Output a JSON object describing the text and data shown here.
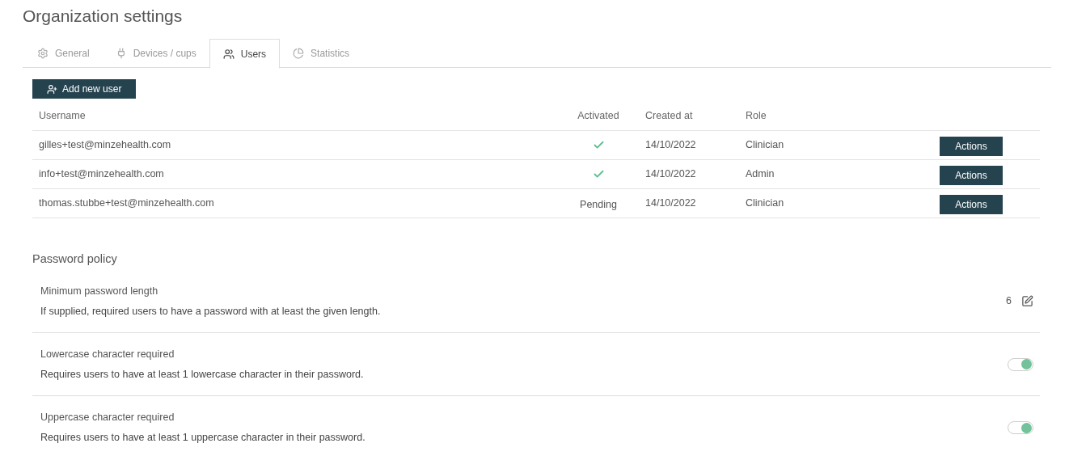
{
  "title": "Organization settings",
  "tabs": [
    {
      "label": "General",
      "selected": false
    },
    {
      "label": "Devices / cups",
      "selected": false
    },
    {
      "label": "Users",
      "selected": true
    },
    {
      "label": "Statistics",
      "selected": false
    }
  ],
  "add_button": "Add new user",
  "table": {
    "columns": [
      "Username",
      "Activated",
      "Created at",
      "Role"
    ],
    "rows": [
      {
        "username": "gilles+test@minzehealth.com",
        "activated": true,
        "created_at": "14/10/2022",
        "role": "Clinician",
        "action": "Actions"
      },
      {
        "username": "info+test@minzehealth.com",
        "activated": true,
        "created_at": "14/10/2022",
        "role": "Admin",
        "action": "Actions"
      },
      {
        "username": "thomas.stubbe+test@minzehealth.com",
        "activated": false,
        "status": "Pending",
        "created_at": "14/10/2022",
        "role": "Clinician",
        "action": "Actions"
      }
    ]
  },
  "password_policy": {
    "heading": "Password policy",
    "items": [
      {
        "kind": "value",
        "title": "Minimum password length",
        "description": "If supplied, required users to have a password with at least the given length.",
        "value": "6"
      },
      {
        "kind": "toggle",
        "title": "Lowercase character required",
        "description": "Requires users to have at least 1 lowercase character in their password.",
        "on": true
      },
      {
        "kind": "toggle",
        "title": "Uppercase character required",
        "description": "Requires users to have at least 1 uppercase character in their password.",
        "on": true
      }
    ]
  }
}
